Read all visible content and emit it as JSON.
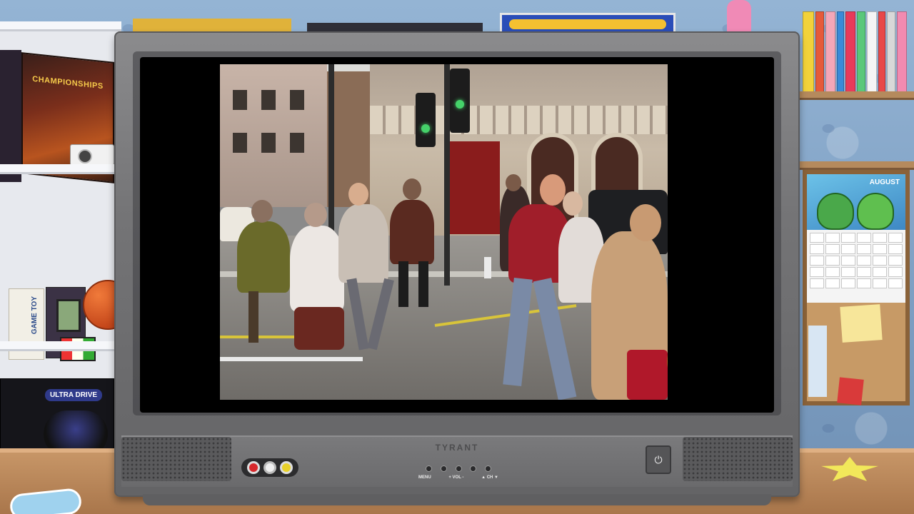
{
  "tv": {
    "brand": "TYRANT",
    "buttons": [
      {
        "label": "MENU"
      },
      {
        "label": "+ VOL -"
      },
      {
        "label": "▲ CH ▼"
      }
    ],
    "power_symbol": "⏻"
  },
  "room": {
    "left_shelf": {
      "box_title": "CHAMPIONSHIPS",
      "console_box_label": "ULTRA DRIVE",
      "handheld_box_label": "GAME TOY"
    },
    "calendar": {
      "month": "AUGUST"
    }
  },
  "video": {
    "watermark_icon": "back-n-time-games-logo"
  },
  "colors": {
    "tv_body": "#747476",
    "screen": "#000000",
    "table": "#a9764b",
    "wall": "#7d9ec2"
  }
}
